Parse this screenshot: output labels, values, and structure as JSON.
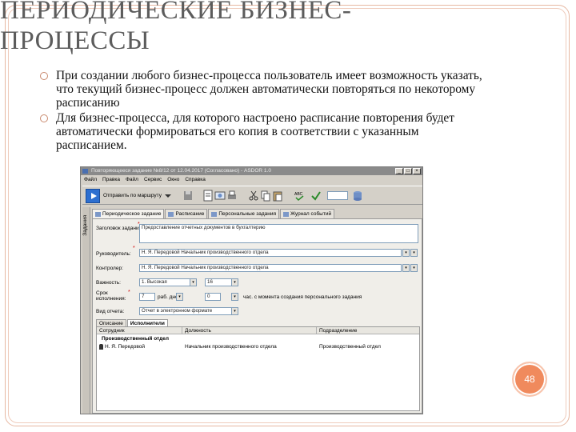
{
  "slide": {
    "title_line1": "ПЕРИОДИЧЕСКИЕ БИЗНЕС-",
    "title_line2": "ПРОЦЕССЫ",
    "bullets": [
      "При создании любого бизнес-процесса пользователь имеет возможность указать, что текущий бизнес-процесс должен автоматически повторяться по некоторому расписанию",
      "Для  бизнес-процесса, для которого настроено расписание повторения будет автоматически формироваться его копия в соответствии с указанным расписанием."
    ],
    "page_number": "48",
    "accent_color": "#f08a5d",
    "frame_color": "#e7b8a2"
  },
  "window": {
    "title": "Повторяющееся задание №8/12 от 12.04.2017 (Согласовано) - ASDOR 1.0",
    "menu": [
      "Файл",
      "Правка",
      "Файл",
      "Сервис",
      "Окно",
      "Справка"
    ],
    "send_label": "Отправить по маршруту",
    "window_buttons": [
      "_",
      "□",
      "×"
    ],
    "sidebar_label": "Задания",
    "tabs": [
      "Периодическое задание",
      "Расписание",
      "Персональные задания",
      "Журнал событий"
    ],
    "form": {
      "subject_label": "Заголовок задания:",
      "subject_value": "Предоставление отчетных документов в бухгалтерию",
      "manager_label": "Руководитель:",
      "manager_value": "Н. Я. Передовой Начальник производственного отдела",
      "controller_label": "Контролер:",
      "controller_value": "Н. Я. Передовой Начальник производственного отдела",
      "priority_label": "Важность:",
      "priority_value": "1. Высокая",
      "priority_num": "16",
      "term_label": "Срок исполнения:",
      "term_value": "7",
      "term_unit": "раб. дней",
      "term_hint": "час. с момента создания персонального задания",
      "term_small": "0",
      "report_label": "Вид отчета:",
      "report_value": "Отчет в электронном формате"
    },
    "subtabs": [
      "Описание",
      "Исполнители"
    ],
    "grid": {
      "headers": [
        "Сотрудник",
        "Должность",
        "Подразделение"
      ],
      "group": "Производственный отдел",
      "rows": [
        [
          "Н. Я. Передовой",
          "Начальник производственного отдела",
          "Производственный отдел"
        ]
      ]
    }
  }
}
